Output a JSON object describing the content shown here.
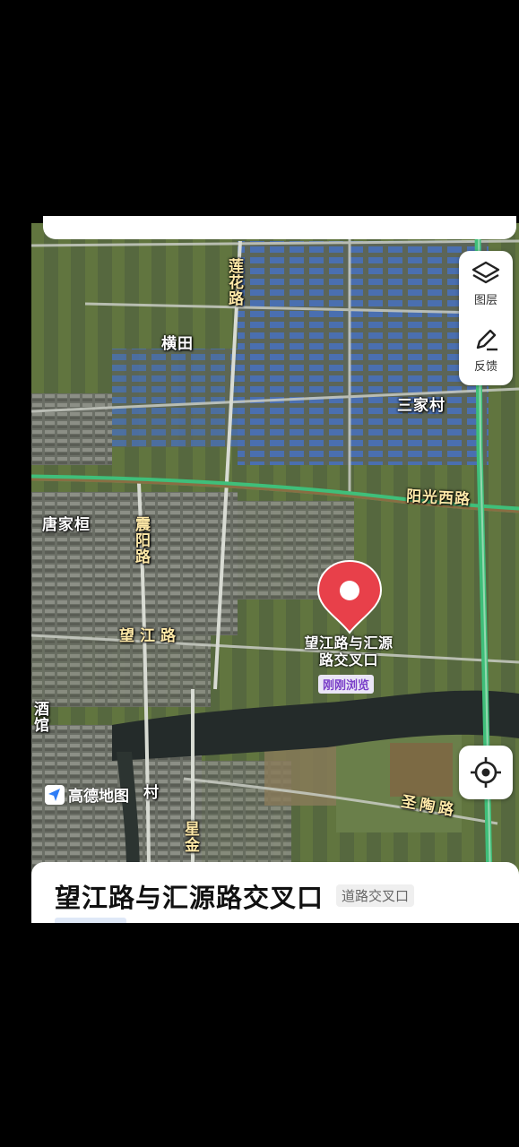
{
  "map_provider": "高德地图",
  "controls": {
    "layers_label": "图层",
    "feedback_label": "反馈"
  },
  "place_names": {
    "henghtian": "横田",
    "sanjiacun": "三家村",
    "tangjiagui": "唐家桓",
    "jiuguan": "酒馆",
    "cun": "村"
  },
  "road_names": {
    "lianhua": "莲花路",
    "yangguangxi": "阳光西路",
    "zhenyang": "震阳路",
    "wangjiang": "望江路",
    "shengtao": "圣陶路",
    "xingjin": "星金"
  },
  "marker": {
    "label": "望江路与汇源路交叉口",
    "badge": "刚刚浏览",
    "color": "#e8404a"
  },
  "sheet": {
    "title": "望江路与汇源路交叉口",
    "tag": "道路交叉口"
  },
  "colors": {
    "main_road": "#3fbf7a",
    "road_label": "#ffe9a8"
  }
}
